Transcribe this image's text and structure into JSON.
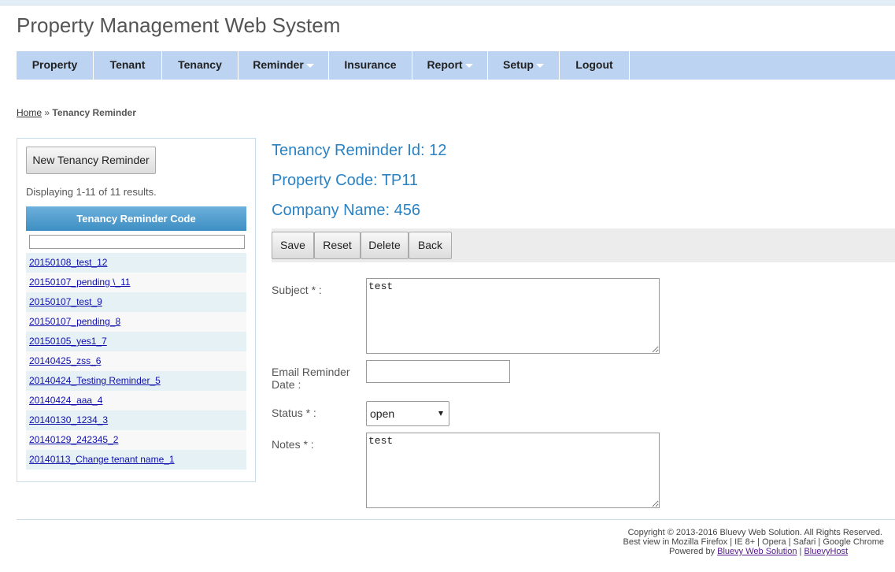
{
  "app": {
    "title": "Property Management Web System"
  },
  "menu": [
    {
      "label": "Property",
      "has_dropdown": false
    },
    {
      "label": "Tenant",
      "has_dropdown": false
    },
    {
      "label": "Tenancy",
      "has_dropdown": false
    },
    {
      "label": "Reminder",
      "has_dropdown": true
    },
    {
      "label": "Insurance",
      "has_dropdown": false
    },
    {
      "label": "Report",
      "has_dropdown": true
    },
    {
      "label": "Setup",
      "has_dropdown": true
    },
    {
      "label": "Logout",
      "has_dropdown": false
    }
  ],
  "breadcrumb": {
    "home": "Home",
    "separator": "»",
    "current": "Tenancy Reminder"
  },
  "sidebar": {
    "new_button": "New Tenancy Reminder",
    "summary": "Displaying 1-11 of 11 results.",
    "column_header": "Tenancy Reminder Code",
    "filter_value": "",
    "rows": [
      "20150108_test_12",
      "20150107_pending \\_11",
      "20150107_test_9",
      "20150107_pending_8",
      "20150105_yes1_7",
      "20140425_zss_6",
      "20140424_Testing Reminder_5",
      "20140424_aaa_4",
      "20140130_1234_3",
      "20140129_242345_2",
      "20140113_Change tenant name_1"
    ]
  },
  "detail": {
    "reminder_id": "Tenancy Reminder Id: 12",
    "property_code": "Property Code: TP11",
    "company_name": "Company Name: 456"
  },
  "actions": {
    "save": "Save",
    "reset": "Reset",
    "delete": "Delete",
    "back": "Back"
  },
  "form": {
    "subject_label": "Subject * :",
    "subject_value": "test",
    "email_date_label_1": "Email Reminder",
    "email_date_label_2": "Date :",
    "email_date_value": "",
    "status_label": "Status * :",
    "status_value": "open",
    "notes_label": "Notes * :",
    "notes_value": "test"
  },
  "footer": {
    "copyright": "Copyright © 2013-2016 Bluevy Web Solution. All Rights Reserved.",
    "best_view": "Best view in Mozilla Firefox | IE 8+ | Opera | Safari | Google Chrome",
    "powered_by": "Powered by",
    "link1": "Bluevy Web Solution",
    "sep": "|",
    "link2": "BluevyHost"
  },
  "colors": {
    "menu_bg": "#bcd3f1",
    "heading": "#2a82c3",
    "grid_header": "#4a9acd",
    "row_alt": "#e5f1f4"
  }
}
